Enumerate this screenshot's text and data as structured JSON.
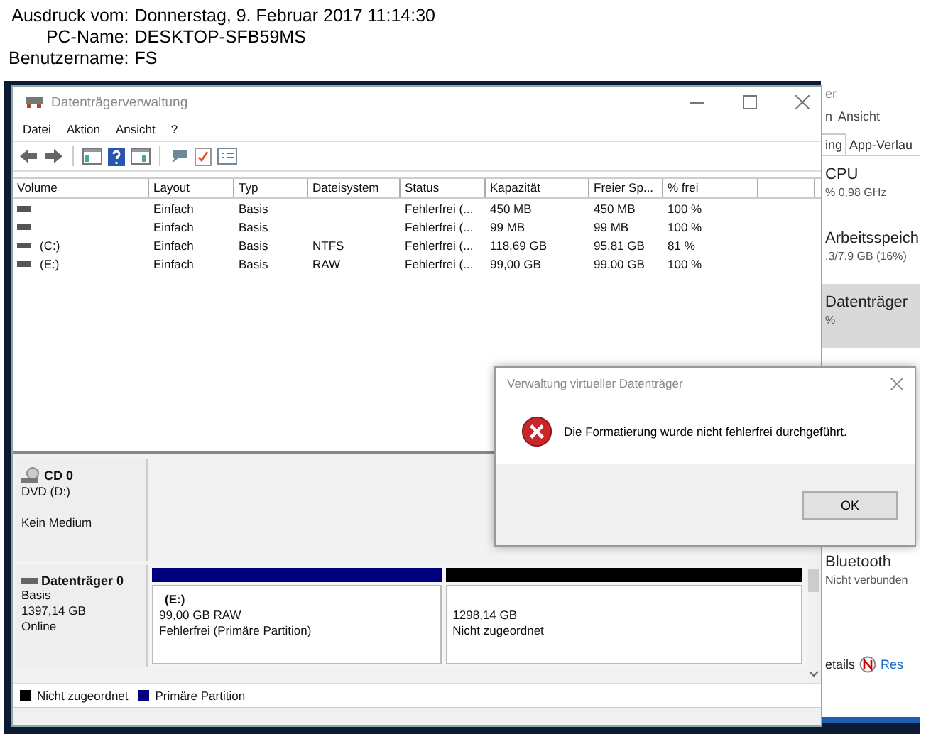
{
  "print_header": [
    {
      "label": "Ausdruck vom:",
      "value": "Donnerstag, 9. Februar 2017 11:14:30"
    },
    {
      "label": "PC-Name:",
      "value": "DESKTOP-SFB59MS"
    },
    {
      "label": "Benutzername:",
      "value": "FS"
    }
  ],
  "background_window": {
    "title": "er",
    "menu": [
      "n",
      "Ansicht"
    ],
    "tabs": [
      {
        "label": "ing",
        "selected": true
      },
      {
        "label": "App-Verlau",
        "selected": false
      }
    ],
    "resources": [
      {
        "name": "CPU",
        "detail": "% 0,98 GHz",
        "selected": false
      },
      {
        "name": "Arbeitsspeich",
        "detail": ",3/7,9 GB (16%)",
        "selected": false
      },
      {
        "name": "Datenträger",
        "detail": "%",
        "selected": true
      },
      {
        "name": "Bluetooth",
        "detail": "Nicht verbunden",
        "selected": false
      }
    ],
    "footer": {
      "details": "etails",
      "link": "Res"
    }
  },
  "main_window": {
    "title": "Datenträgerverwaltung",
    "menu": [
      "Datei",
      "Aktion",
      "Ansicht",
      "?"
    ],
    "table": {
      "columns": [
        "Volume",
        "Layout",
        "Typ",
        "Dateisystem",
        "Status",
        "Kapazität",
        "Freier Sp...",
        "% frei"
      ],
      "rows": [
        {
          "cells": [
            "",
            "Einfach",
            "Basis",
            "",
            "Fehlerfrei (...",
            "450 MB",
            "450 MB",
            "100 %"
          ]
        },
        {
          "cells": [
            "",
            "Einfach",
            "Basis",
            "",
            "Fehlerfrei (...",
            "99 MB",
            "99 MB",
            "100 %"
          ]
        },
        {
          "cells": [
            "(C:)",
            "Einfach",
            "Basis",
            "NTFS",
            "Fehlerfrei (...",
            "118,69 GB",
            "95,81 GB",
            "81 %"
          ]
        },
        {
          "cells": [
            "(E:)",
            "Einfach",
            "Basis",
            "RAW",
            "Fehlerfrei (...",
            "99,00 GB",
            "99,00 GB",
            "100 %"
          ]
        }
      ]
    },
    "disks": [
      {
        "kind": "cd",
        "name": "CD 0",
        "lines": [
          "DVD (D:)",
          "Kein Medium"
        ]
      },
      {
        "kind": "disk",
        "name": "Datenträger 0",
        "lines": [
          "Basis",
          "1397,14 GB",
          "Online"
        ],
        "partitions": [
          {
            "color": "#00007f",
            "label": "(E:)",
            "lines": [
              "99,00 GB RAW",
              "Fehlerfrei (Primäre Partition)"
            ]
          },
          {
            "color": "#000000",
            "lines": [
              "1298,14 GB",
              "Nicht zugeordnet"
            ]
          }
        ]
      }
    ],
    "legend": [
      {
        "label": "Nicht zugeordnet",
        "color": "#000000"
      },
      {
        "label": "Primäre Partition",
        "color": "#00007f"
      }
    ]
  },
  "dialog": {
    "title": "Verwaltung virtueller Datenträger",
    "message": "Die Formatierung wurde nicht fehlerfrei durchgeführt.",
    "buttons": [
      "OK"
    ]
  }
}
